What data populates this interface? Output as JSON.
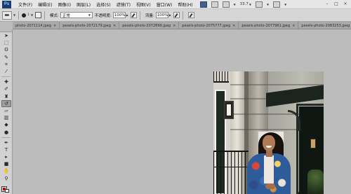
{
  "app": {
    "logo": "Ps"
  },
  "menu": {
    "items": [
      {
        "label": "文件(F)"
      },
      {
        "label": "编辑(E)"
      },
      {
        "label": "图像(I)"
      },
      {
        "label": "图层(L)"
      },
      {
        "label": "选择(S)"
      },
      {
        "label": "滤镜(T)"
      },
      {
        "label": "视图(V)"
      },
      {
        "label": "窗口(W)"
      },
      {
        "label": "帮助(H)"
      }
    ],
    "zoom_value": "33.7",
    "window_buttons": [
      "–",
      "□",
      "×"
    ]
  },
  "options": {
    "brush_size": "1",
    "mode_label": "模式:",
    "mode_value": "正常",
    "opacity_label": "不透明度:",
    "opacity_value": "100%",
    "flow_label": "流量:",
    "flow_value": "100%"
  },
  "tabs": [
    {
      "label": "photo-2071114.jpeg"
    },
    {
      "label": "pexels-photo-2072179.jpeg"
    },
    {
      "label": "pexels-photo-2072899.jpeg"
    },
    {
      "label": "pexels-photo-2075777.jpeg"
    },
    {
      "label": "pexels-photo-2077961.jpeg"
    },
    {
      "label": "pexels-photo-2083253.jpeg"
    }
  ],
  "tabs_more": "»",
  "tab_close": "×",
  "toolbox": {
    "tools": [
      {
        "name": "move",
        "glyph": "➤"
      },
      {
        "name": "marquee",
        "glyph": "⬚"
      },
      {
        "name": "lasso",
        "glyph": "ʘ"
      },
      {
        "name": "quick-select",
        "glyph": "✎"
      },
      {
        "name": "crop",
        "glyph": "⌗"
      },
      {
        "name": "eyedropper",
        "glyph": "⁄"
      },
      {
        "name": "spot-heal",
        "glyph": "✚"
      },
      {
        "name": "brush",
        "glyph": "✐"
      },
      {
        "name": "stamp",
        "glyph": "♜"
      },
      {
        "name": "history-brush",
        "glyph": "↺"
      },
      {
        "name": "eraser",
        "glyph": "▱"
      },
      {
        "name": "gradient",
        "glyph": "▥"
      },
      {
        "name": "blur",
        "glyph": "◆"
      },
      {
        "name": "dodge",
        "glyph": "●"
      },
      {
        "name": "pen",
        "glyph": "✒"
      },
      {
        "name": "type",
        "glyph": "T"
      },
      {
        "name": "path-select",
        "glyph": "▸"
      },
      {
        "name": "shape",
        "glyph": "■"
      },
      {
        "name": "hand",
        "glyph": "✋"
      },
      {
        "name": "zoom",
        "glyph": "⚲"
      }
    ],
    "active_tool": "history-brush",
    "foreground_color": "#cc0000",
    "background_color": "#ffffff"
  },
  "colors": {
    "menubar": "#e6e6e6",
    "optionsbar": "#d6d6d6",
    "workspace": "#bcbcbc"
  }
}
